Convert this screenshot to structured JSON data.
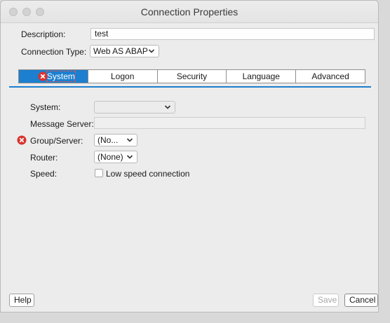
{
  "window": {
    "title": "Connection Properties"
  },
  "form": {
    "description_label": "Description:",
    "description_value": "test",
    "connection_type_label": "Connection Type:",
    "connection_type_value": "Web AS ABAP"
  },
  "tabs": [
    {
      "label": "System",
      "active": true,
      "error": true
    },
    {
      "label": "Logon"
    },
    {
      "label": "Security"
    },
    {
      "label": "Language"
    },
    {
      "label": "Advanced"
    }
  ],
  "system_tab": {
    "system_label": "System:",
    "system_value": "",
    "message_server_label": "Message Server:",
    "message_server_value": "",
    "group_server_label": "Group/Server:",
    "group_server_value": "(No...",
    "router_label": "Router:",
    "router_value": "(None)",
    "speed_label": "Speed:",
    "low_speed_label": "Low speed connection",
    "low_speed_checked": false
  },
  "buttons": {
    "help": "Help",
    "save": "Save",
    "cancel": "Cancel"
  },
  "icons": [
    "error-icon",
    "chevron-down-icon"
  ],
  "colors": {
    "accent": "#1c7fcf",
    "error": "#d9322e"
  }
}
